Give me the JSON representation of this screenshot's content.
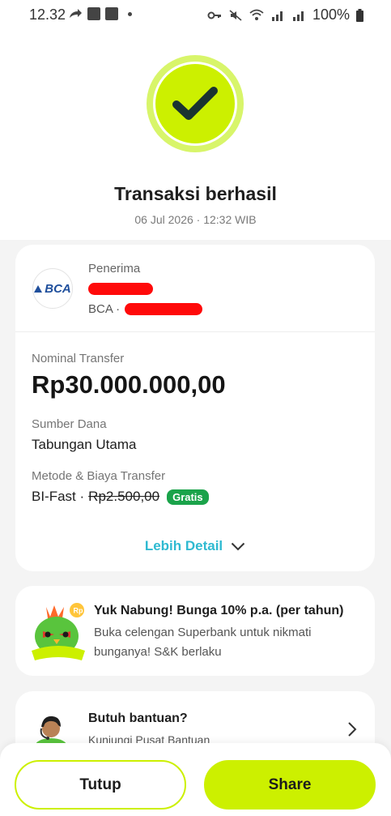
{
  "status_bar": {
    "time": "12.32",
    "battery": "100%"
  },
  "header": {
    "title": "Transaksi berhasil",
    "datetime": "06 Jul 2026 · 12:32 WIB"
  },
  "recipient": {
    "label": "Penerima",
    "bank_logo": "BCA",
    "bank_name": "BCA ·"
  },
  "transfer": {
    "amount_label": "Nominal Transfer",
    "amount": "Rp30.000.000,00",
    "source_label": "Sumber Dana",
    "source_value": "Tabungan Utama",
    "method_label": "Metode & Biaya Transfer",
    "method": "BI-Fast ·",
    "original_fee": "Rp2.500,00",
    "fee_badge": "Gratis",
    "detail_link": "Lebih Detail"
  },
  "promo": {
    "title": "Yuk Nabung! Bunga 10% p.a. (per tahun)",
    "description": "Buka celengan Superbank untuk nikmati bunganya! S&K berlaku"
  },
  "help": {
    "title": "Butuh bantuan?",
    "subtitle": "Kunjungi Pusat Bantuan"
  },
  "actions": {
    "close_label": "Tutup",
    "share_label": "Share"
  },
  "colors": {
    "accent": "#ccf000",
    "link": "#2fbad1",
    "badge": "#1aa34a",
    "redaction": "#ff0a0a"
  }
}
